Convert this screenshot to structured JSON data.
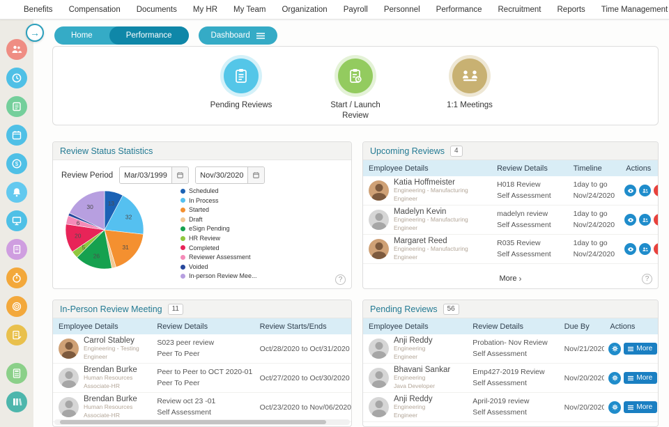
{
  "topnav": {
    "items": [
      "Benefits",
      "Compensation",
      "Documents",
      "My HR",
      "My Team",
      "Organization",
      "Payroll",
      "Personnel",
      "Performance",
      "Recruitment",
      "Reports",
      "Time Management"
    ]
  },
  "tabs": {
    "home": "Home",
    "performance": "Performance",
    "dashboard": "Dashboard"
  },
  "icons": {
    "help": "?",
    "arrow_right": "→",
    "chevron": "›"
  },
  "quick_actions": {
    "pending": {
      "label": "Pending Reviews"
    },
    "start": {
      "label": "Start / Launch Review"
    },
    "meetings": {
      "label": "1:1 Meetings"
    }
  },
  "stats": {
    "title": "Review Status Statistics",
    "period_label": "Review Period",
    "date_from": "Mar/03/1999",
    "date_to": "Nov/30/2020"
  },
  "chart_data": {
    "type": "pie",
    "title": "Review Status Statistics",
    "labels": [
      "Scheduled",
      "In Process",
      "Started",
      "Draft",
      "eSign Pending",
      "HR Review",
      "Completed",
      "Reviewer Assessment",
      "Voided",
      "In-person Review Mee..."
    ],
    "values": [
      13,
      32,
      31,
      3,
      26,
      5,
      20,
      6,
      2,
      30
    ],
    "colors": [
      "#1b62b5",
      "#55c0f0",
      "#f49030",
      "#f2c894",
      "#16a14f",
      "#8fc73e",
      "#e82458",
      "#f48bb8",
      "#27489c",
      "#b79fe0"
    ],
    "legend_position": "right"
  },
  "upcoming": {
    "title": "Upcoming Reviews",
    "badge": "4",
    "headers": [
      "Employee Details",
      "Review Details",
      "Timeline",
      "Actions"
    ],
    "rows": [
      {
        "name": "Katia Hoffmeister",
        "dept": "Engineering - Manufacturing",
        "role": "Engineer",
        "review": "H018 Review",
        "type": "Self Assessment",
        "timeline": "1day to go",
        "date": "Nov/24/2020"
      },
      {
        "name": "Madelyn Kevin",
        "dept": "Engineering - Manufacturing",
        "role": "Engineer",
        "review": "madelyn review",
        "type": "Self Assessment",
        "timeline": "1day to go",
        "date": "Nov/24/2020"
      },
      {
        "name": "Margaret Reed",
        "dept": "Engineering - Manufacturing",
        "role": "Engineer",
        "review": "R035 Review",
        "type": "Self Assessment",
        "timeline": "1day to go",
        "date": "Nov/24/2020"
      }
    ],
    "more_label": "More"
  },
  "inperson": {
    "title": "In-Person Review Meeting",
    "badge": "11",
    "headers": [
      "Employee Details",
      "Review Details",
      "Review Starts/Ends"
    ],
    "rows": [
      {
        "name": "Carrol Stabley",
        "dept": "Engineering - Testing",
        "role": "Engineer",
        "review": "S023 peer review",
        "type": "Peer To Peer",
        "dates": "Oct/28/2020 to Oct/31/2020"
      },
      {
        "name": "Brendan Burke",
        "dept": "Human Resources",
        "role": "Associate-HR",
        "review": "Peer to Peer to OCT 2020-01",
        "type": "Peer To Peer",
        "dates": "Oct/27/2020 to Oct/30/2020"
      },
      {
        "name": "Brendan Burke",
        "dept": "Human Resources",
        "role": "Associate-HR",
        "review": "Review oct 23 -01",
        "type": "Self Assessment",
        "dates": "Oct/23/2020 to Nov/06/2020"
      }
    ]
  },
  "pending": {
    "title": "Pending Reviews",
    "badge": "56",
    "headers": [
      "Employee Details",
      "Review Details",
      "Due By",
      "Actions"
    ],
    "more_button": "More",
    "rows": [
      {
        "name": "Anji Reddy",
        "dept": "Engineering",
        "role": "Engineer",
        "review": "Probation- Nov Review",
        "type": "Self Assessment",
        "due": "Nov/21/2020"
      },
      {
        "name": "Bhavani Sankar",
        "dept": "Engineering",
        "role": "Java Developer",
        "review": "Emp427-2019 Review",
        "type": "Self Assessment",
        "due": "Nov/20/2020"
      },
      {
        "name": "Anji Reddy",
        "dept": "Engineering",
        "role": "Engineer",
        "review": "April-2019 review",
        "type": "Self Assessment",
        "due": "Nov/20/2020"
      }
    ]
  },
  "sidebar": {
    "icons": [
      "employees",
      "time",
      "tasks",
      "calendar",
      "payroll",
      "notifications",
      "workstation",
      "documents",
      "timer",
      "goals",
      "ledger",
      "calculator",
      "library"
    ]
  }
}
